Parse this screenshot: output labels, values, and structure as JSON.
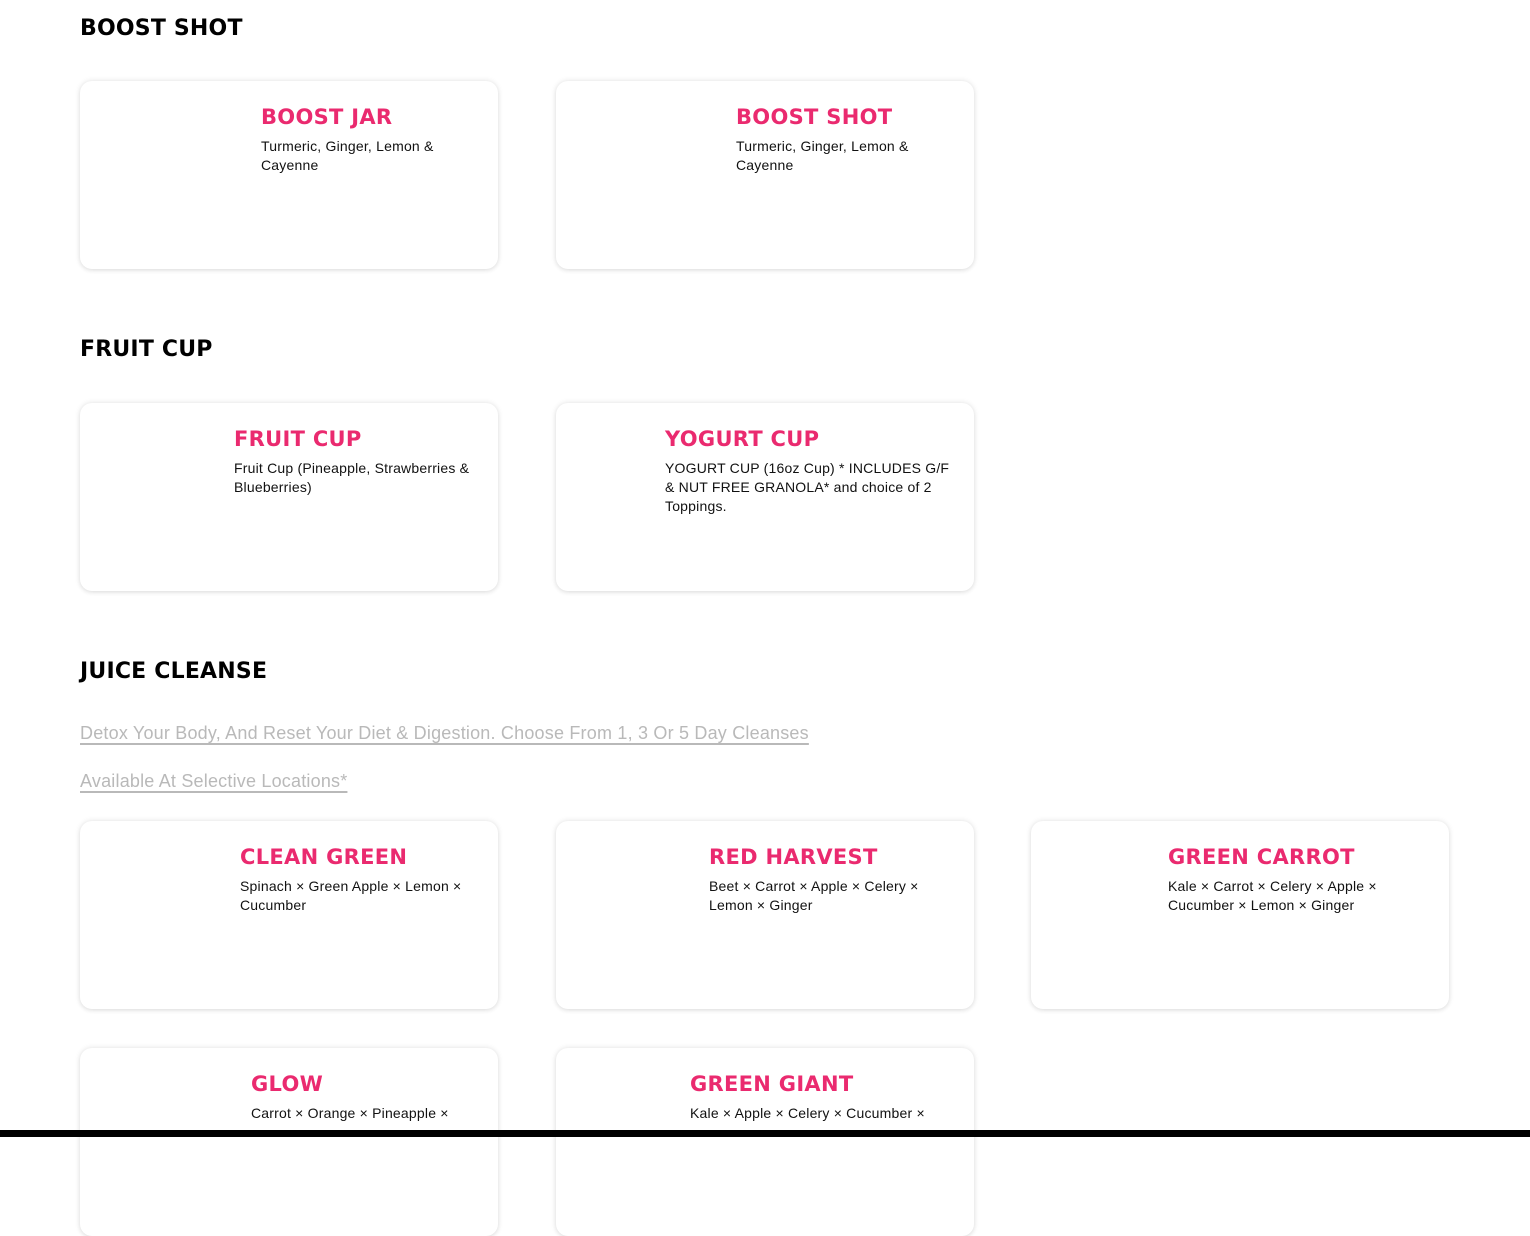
{
  "sections": {
    "boost_shot": {
      "title": "BOOST SHOT",
      "items": [
        {
          "name": "BOOST JAR",
          "desc": "Turmeric, Ginger, Lemon & Cayenne"
        },
        {
          "name": "BOOST SHOT",
          "desc": "Turmeric, Ginger, Lemon & Cayenne"
        }
      ]
    },
    "fruit_cup": {
      "title": "FRUIT CUP",
      "items": [
        {
          "name": "FRUIT CUP",
          "desc": "Fruit Cup (Pineapple, Strawberries & Blueberries)"
        },
        {
          "name": "YOGURT CUP",
          "desc": "YOGURT CUP (16oz Cup) * INCLUDES G/F & NUT FREE GRANOLA* and choice of 2 Toppings."
        }
      ]
    },
    "juice_cleanse": {
      "title": "JUICE CLEANSE",
      "link_1": "Detox Your Body, And Reset Your Diet & Digestion. Choose From 1, 3 Or 5 Day Cleanses",
      "link_2": "Available At Selective Locations*",
      "items": [
        {
          "name": "CLEAN GREEN",
          "desc": "Spinach × Green Apple × Lemon × Cucumber"
        },
        {
          "name": "RED HARVEST",
          "desc": "Beet × Carrot × Apple × Celery × Lemon × Ginger"
        },
        {
          "name": "GREEN CARROT",
          "desc": "Kale × Carrot × Celery × Apple × Cucumber × Lemon × Ginger"
        },
        {
          "name": "GLOW",
          "desc": "Carrot × Orange × Pineapple ×"
        },
        {
          "name": "GREEN GIANT",
          "desc": "Kale × Apple × Celery × Cucumber ×"
        }
      ]
    }
  },
  "colors": {
    "accent": "#ea2a6f",
    "link": "#b9b9b9",
    "text": "#111111"
  }
}
